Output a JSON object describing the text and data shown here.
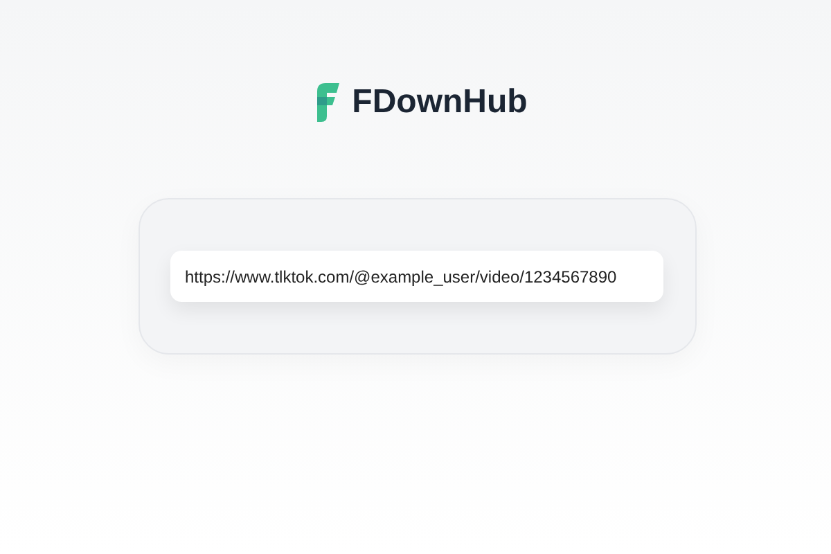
{
  "brand": {
    "name": "FDownHub"
  },
  "url_field": {
    "value": "https://www.tlktok.com/@example_user/video/1234567890"
  }
}
